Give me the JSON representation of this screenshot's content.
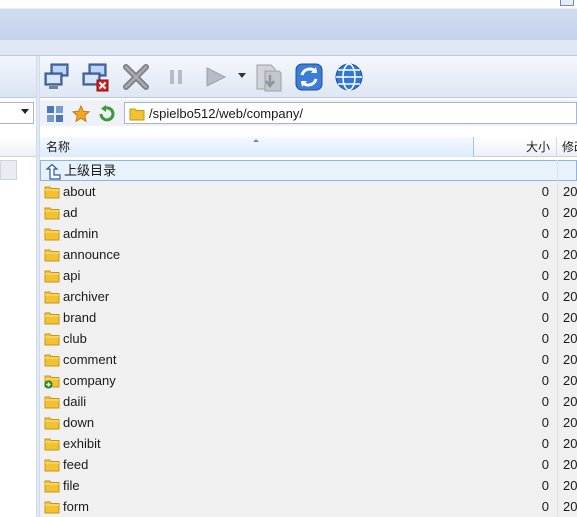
{
  "toolbar": {
    "buttons": [
      {
        "icon": "connect-computers-icon"
      },
      {
        "icon": "disconnect-icon"
      },
      {
        "icon": "stop-x-icon"
      },
      {
        "icon": "pause-icon"
      },
      {
        "icon": "play-icon"
      },
      {
        "icon": "transfer-queue-icon"
      },
      {
        "icon": "refresh-icon"
      },
      {
        "icon": "globe-icon"
      }
    ]
  },
  "addressbar": {
    "path": "/spielbo512/web/company/"
  },
  "columns": {
    "name": "名称",
    "size": "大小",
    "date": "修改"
  },
  "parent_row": {
    "label": "上级目录"
  },
  "files": [
    {
      "name": "about",
      "size": "0",
      "date": "20"
    },
    {
      "name": "ad",
      "size": "0",
      "date": "20"
    },
    {
      "name": "admin",
      "size": "0",
      "date": "20"
    },
    {
      "name": "announce",
      "size": "0",
      "date": "20"
    },
    {
      "name": "api",
      "size": "0",
      "date": "20"
    },
    {
      "name": "archiver",
      "size": "0",
      "date": "20"
    },
    {
      "name": "brand",
      "size": "0",
      "date": "20"
    },
    {
      "name": "club",
      "size": "0",
      "date": "20"
    },
    {
      "name": "comment",
      "size": "0",
      "date": "20"
    },
    {
      "name": "company",
      "size": "0",
      "date": "20",
      "badge": "green-plus"
    },
    {
      "name": "daili",
      "size": "0",
      "date": "20"
    },
    {
      "name": "down",
      "size": "0",
      "date": "20"
    },
    {
      "name": "exhibit",
      "size": "0",
      "date": "20"
    },
    {
      "name": "feed",
      "size": "0",
      "date": "20"
    },
    {
      "name": "file",
      "size": "0",
      "date": "20"
    },
    {
      "name": "form",
      "size": "0",
      "date": "20"
    }
  ],
  "colors": {
    "folder": "#f2c230",
    "selection_border": "#8fb4de",
    "header_active": "#dcebfb"
  }
}
